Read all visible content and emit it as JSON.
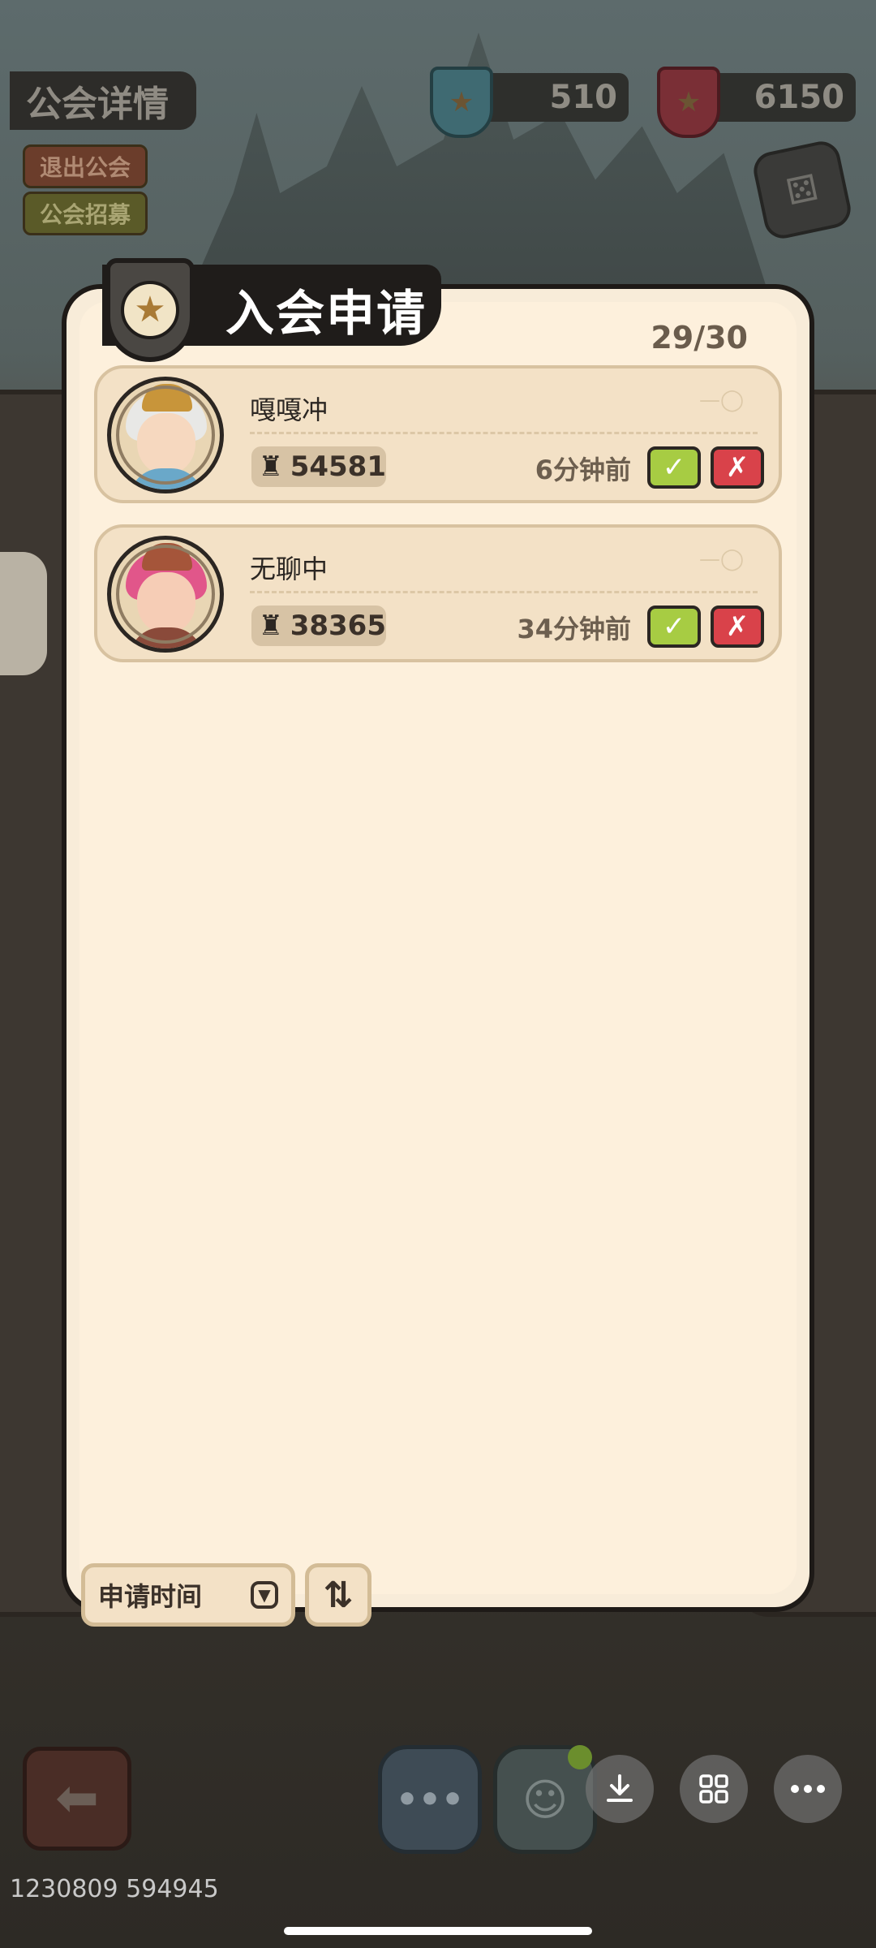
{
  "header": {
    "guild_title": "公会详情",
    "exit_guild": "退出公会",
    "recruit": "公会招募",
    "currency_1": "510",
    "currency_2": "6150"
  },
  "popup": {
    "title": "入会申请",
    "count": "29/30",
    "requests": [
      {
        "name": "嘎嘎冲",
        "power": "54581",
        "time": "6分钟前"
      },
      {
        "name": "无聊中",
        "power": "38365",
        "time": "34分钟前"
      }
    ],
    "sort_label": "申请时间"
  },
  "icons": {
    "accept": "check-icon",
    "reject": "cross-icon",
    "power": "power-icon"
  },
  "colors": {
    "accept": "#a7cc43",
    "reject": "#d9424a",
    "panel": "#fdf0dc"
  },
  "footer": {
    "id_text": "1230809 594945"
  }
}
